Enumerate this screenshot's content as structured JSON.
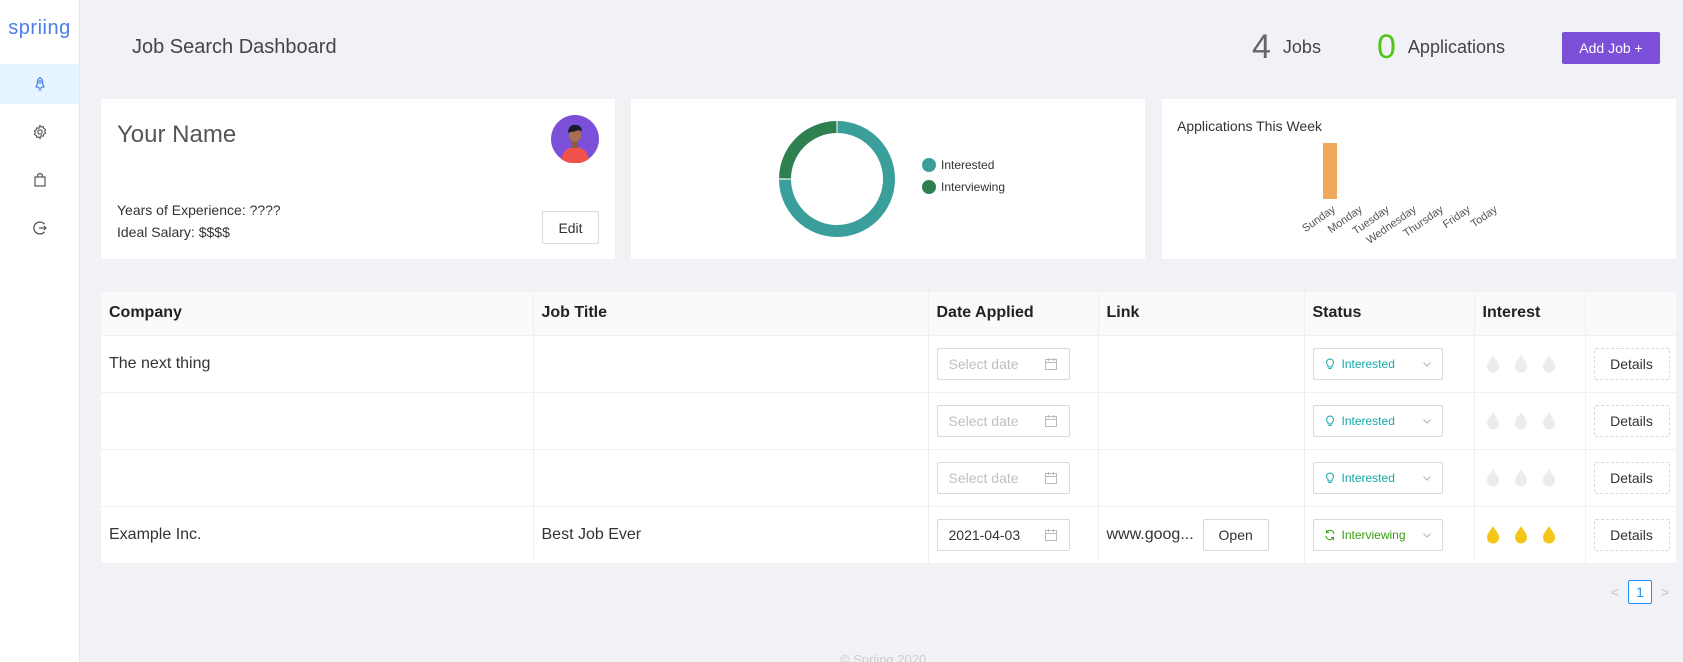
{
  "sidebar": {
    "logo": "spriing",
    "items": [
      {
        "icon": "rocket-icon",
        "active": true
      },
      {
        "icon": "gear-icon",
        "active": false
      },
      {
        "icon": "shopping-bag-icon",
        "active": false
      },
      {
        "icon": "logout-icon",
        "active": false
      }
    ]
  },
  "header": {
    "title": "Job Search Dashboard",
    "jobs_count": "4",
    "jobs_label": "Jobs",
    "apps_count": "0",
    "apps_label": "Applications",
    "add_button": "Add Job +"
  },
  "profile": {
    "name": "Your Name",
    "experience": "Years of Experience: ????",
    "salary": "Ideal Salary: $$$$",
    "edit_label": "Edit"
  },
  "status_chart": {
    "chart_data": {
      "type": "pie",
      "series": [
        {
          "name": "Interested",
          "value": 3,
          "color": "#3a9e9b"
        },
        {
          "name": "Interviewing",
          "value": 1,
          "color": "#2e8050"
        }
      ]
    }
  },
  "weekly_chart": {
    "title": "Applications This Week",
    "chart_data": {
      "type": "bar",
      "categories": [
        "Sunday",
        "Monday",
        "Tuesday",
        "Wednesday",
        "Thursday",
        "Friday",
        "Today"
      ],
      "values": [
        1,
        0,
        0,
        0,
        0,
        0,
        0
      ],
      "color": "#f0a85a"
    }
  },
  "table": {
    "headers": [
      "Company",
      "Job Title",
      "Date Applied",
      "Link",
      "Status",
      "Interest",
      ""
    ],
    "date_placeholder": "Select date",
    "details_label": "Details",
    "open_label": "Open",
    "rows": [
      {
        "company": "The next thing",
        "job_title": "",
        "date": "",
        "link": "",
        "status": "Interested",
        "interest": 0
      },
      {
        "company": "",
        "job_title": "",
        "date": "",
        "link": "",
        "status": "Interested",
        "interest": 0
      },
      {
        "company": "",
        "job_title": "",
        "date": "",
        "link": "",
        "status": "Interested",
        "interest": 0
      },
      {
        "company": "Example Inc.",
        "job_title": "Best Job Ever",
        "date": "2021-04-03",
        "link": "www.goog...",
        "status": "Interviewing",
        "interest": 3
      }
    ]
  },
  "pagination": {
    "prev": "<",
    "current": "1",
    "next": ">"
  },
  "footer": "© Spriing 2020"
}
